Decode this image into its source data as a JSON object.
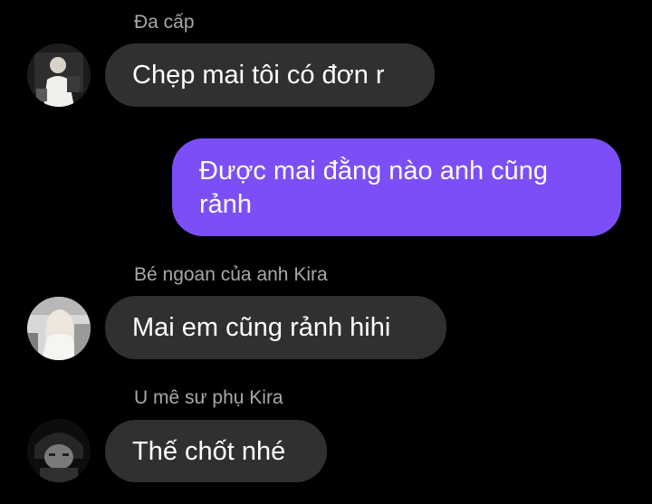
{
  "conversation": {
    "messages": [
      {
        "direction": "incoming",
        "sender": "Đa cấp",
        "text": "Chẹp mai tôi có đơn r",
        "avatar_icon": "user-avatar-icon"
      },
      {
        "direction": "outgoing",
        "text": "Được mai đằng nào anh cũng rảnh"
      },
      {
        "direction": "incoming",
        "sender": "Bé ngoan của anh Kira",
        "text": "Mai em cũng rảnh hihi",
        "avatar_icon": "user-avatar-icon"
      },
      {
        "direction": "incoming",
        "sender": "U mê sư phụ Kira",
        "text": "Thế chốt nhé",
        "avatar_icon": "user-avatar-icon"
      }
    ]
  },
  "colors": {
    "background": "#000000",
    "incoming_bubble": "#303030",
    "outgoing_bubble": "#7b4ff5",
    "sender_name": "#a8a8a8",
    "text": "#ffffff"
  }
}
